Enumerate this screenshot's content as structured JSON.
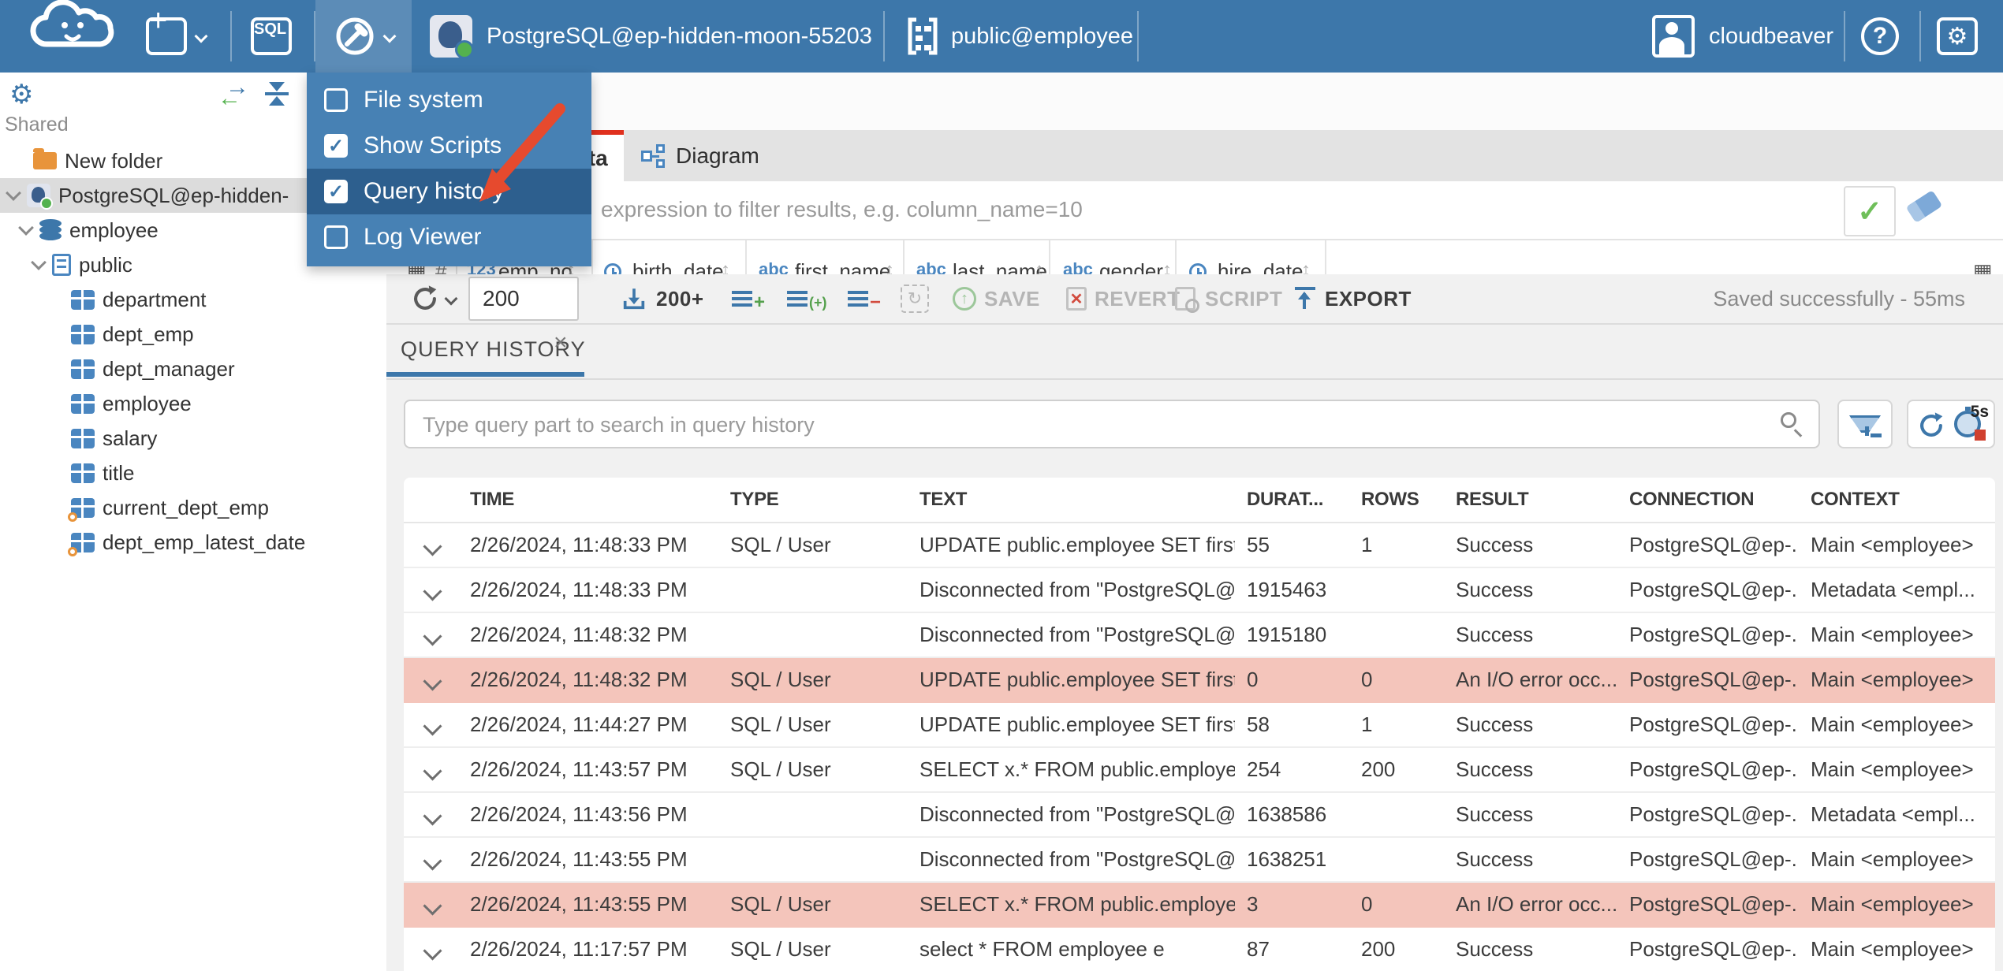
{
  "topbar": {
    "sql_label": "SQL",
    "connection": "PostgreSQL@ep-hidden-moon-55203",
    "schema": "public@employee",
    "user": "cloudbeaver"
  },
  "tools_menu": {
    "items": [
      {
        "label": "File system",
        "checked": false
      },
      {
        "label": "Show Scripts",
        "checked": true
      },
      {
        "label": "Query history",
        "checked": true,
        "highlighted": true
      },
      {
        "label": "Log Viewer",
        "checked": false
      }
    ]
  },
  "sidebar": {
    "section": "Shared",
    "tree": [
      {
        "label": "New folder"
      },
      {
        "label": "PostgreSQL@ep-hidden-"
      },
      {
        "label": "employee"
      },
      {
        "label": "public"
      },
      {
        "label": "department"
      },
      {
        "label": "dept_emp"
      },
      {
        "label": "dept_manager"
      },
      {
        "label": "employee"
      },
      {
        "label": "salary"
      },
      {
        "label": "title"
      },
      {
        "label": "current_dept_emp"
      },
      {
        "label": "dept_emp_latest_date"
      }
    ]
  },
  "result_tabs": {
    "data": "Data",
    "diagram": "Diagram"
  },
  "filter": {
    "placeholder": "expression to filter results, e.g. column_name=10"
  },
  "data_grid": {
    "corner": "#",
    "columns": [
      {
        "icon_text": "123",
        "label": "emp_no"
      },
      {
        "icon_text": "",
        "label": "birth_date"
      },
      {
        "icon_text": "abc",
        "label": "first_name"
      },
      {
        "icon_text": "",
        "label": "last_name"
      },
      {
        "icon_text": "abc",
        "label": "gender"
      },
      {
        "icon_text": "",
        "label": "hire_date"
      }
    ],
    "col2_icon_text": "abc"
  },
  "toolbar": {
    "fetch_size": "200",
    "fetch_more": "200+",
    "save": "SAVE",
    "revert": "REVERT",
    "script": "SCRIPT",
    "export": "EXPORT",
    "status": "Saved successfully - 55ms"
  },
  "query_history": {
    "tab": "QUERY HISTORY",
    "search_placeholder": "Type query part to search in query history",
    "auto_refresh": "5s",
    "columns": [
      "TIME",
      "TYPE",
      "TEXT",
      "DURAT...",
      "ROWS",
      "RESULT",
      "CONNECTION",
      "CONTEXT"
    ],
    "rows": [
      {
        "time": "2/26/2024, 11:48:33 PM",
        "type": "SQL / User",
        "text": "UPDATE public.employee SET first_...",
        "duration": "55",
        "rows": "1",
        "result": "Success",
        "connection": "PostgreSQL@ep-...",
        "context": "Main <employee>",
        "status": "success"
      },
      {
        "time": "2/26/2024, 11:48:33 PM",
        "type": "",
        "text": "Disconnected from \"PostgreSQL@e...",
        "duration": "1915463",
        "rows": "",
        "result": "Success",
        "connection": "PostgreSQL@ep-...",
        "context": "Metadata <empl...",
        "status": "success"
      },
      {
        "time": "2/26/2024, 11:48:32 PM",
        "type": "",
        "text": "Disconnected from \"PostgreSQL@e...",
        "duration": "1915180",
        "rows": "",
        "result": "Success",
        "connection": "PostgreSQL@ep-...",
        "context": "Main <employee>",
        "status": "success"
      },
      {
        "time": "2/26/2024, 11:48:32 PM",
        "type": "SQL / User",
        "text": "UPDATE public.employee SET first_...",
        "duration": "0",
        "rows": "0",
        "result": "An I/O error occ...",
        "connection": "PostgreSQL@ep-...",
        "context": "Main <employee>",
        "status": "error"
      },
      {
        "time": "2/26/2024, 11:44:27 PM",
        "type": "SQL / User",
        "text": "UPDATE public.employee SET first_...",
        "duration": "58",
        "rows": "1",
        "result": "Success",
        "connection": "PostgreSQL@ep-...",
        "context": "Main <employee>",
        "status": "success"
      },
      {
        "time": "2/26/2024, 11:43:57 PM",
        "type": "SQL / User",
        "text": "SELECT x.* FROM public.employee x",
        "duration": "254",
        "rows": "200",
        "result": "Success",
        "connection": "PostgreSQL@ep-...",
        "context": "Main <employee>",
        "status": "success"
      },
      {
        "time": "2/26/2024, 11:43:56 PM",
        "type": "",
        "text": "Disconnected from \"PostgreSQL@e...",
        "duration": "1638586",
        "rows": "",
        "result": "Success",
        "connection": "PostgreSQL@ep-...",
        "context": "Metadata <empl...",
        "status": "success"
      },
      {
        "time": "2/26/2024, 11:43:55 PM",
        "type": "",
        "text": "Disconnected from \"PostgreSQL@e...",
        "duration": "1638251",
        "rows": "",
        "result": "Success",
        "connection": "PostgreSQL@ep-...",
        "context": "Main <employee>",
        "status": "success"
      },
      {
        "time": "2/26/2024, 11:43:55 PM",
        "type": "SQL / User",
        "text": "SELECT x.* FROM public.employee x",
        "duration": "3",
        "rows": "0",
        "result": "An I/O error occ...",
        "connection": "PostgreSQL@ep-...",
        "context": "Main <employee>",
        "status": "error"
      },
      {
        "time": "2/26/2024, 11:17:57 PM",
        "type": "SQL / User",
        "text": "select * FROM employee e",
        "duration": "87",
        "rows": "200",
        "result": "Success",
        "connection": "PostgreSQL@ep-...",
        "context": "Main <employee>",
        "status": "success"
      }
    ]
  },
  "icons": {
    "gear": "⚙",
    "help": "?",
    "plus": "+",
    "close": "×",
    "sort": "↕",
    "grid_small": "▦",
    "sync": "↻",
    "check": "✓",
    "add_badge": "+",
    "dup_badge": "(+)",
    "del_badge": "−",
    "save_arrow": "↑",
    "revert_x": "✕",
    "arrow_right": "→",
    "arrow_left": "←"
  },
  "colors": {
    "topbar": "#3d77aa",
    "menu_highlight": "#2d5f8e",
    "active_tab_indicator": "#e0301e",
    "error_row": "#f4c5bb",
    "accent_blue": "#4a86c0",
    "success_green": "#54b24e",
    "annotation_arrow": "#e64a2e"
  }
}
